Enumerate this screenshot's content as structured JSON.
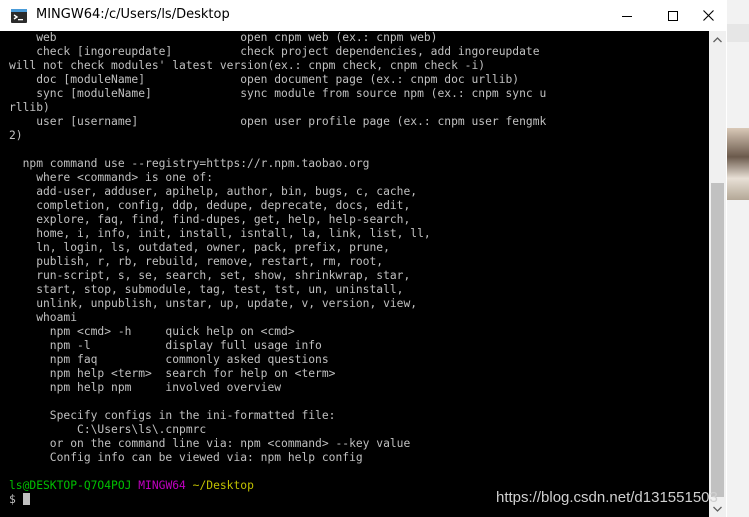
{
  "window": {
    "title": "MINGW64:/c/Users/ls/Desktop"
  },
  "terminal": {
    "lines": [
      "    web                           open cnpm web (ex.: cnpm web)",
      "    check [ingoreupdate]          check project dependencies, add ingoreupdate",
      "will not check modules' latest version(ex.: cnpm check, cnpm check -i)",
      "    doc [moduleName]              open document page (ex.: cnpm doc urllib)",
      "    sync [moduleName]             sync module from source npm (ex.: cnpm sync u",
      "rllib)",
      "    user [username]               open user profile page (ex.: cnpm user fengmk",
      "2)",
      "",
      "  npm command use --registry=https://r.npm.taobao.org",
      "    where <command> is one of:",
      "    add-user, adduser, apihelp, author, bin, bugs, c, cache,",
      "    completion, config, ddp, dedupe, deprecate, docs, edit,",
      "    explore, faq, find, find-dupes, get, help, help-search,",
      "    home, i, info, init, install, isntall, la, link, list, ll,",
      "    ln, login, ls, outdated, owner, pack, prefix, prune,",
      "    publish, r, rb, rebuild, remove, restart, rm, root,",
      "    run-script, s, se, search, set, show, shrinkwrap, star,",
      "    start, stop, submodule, tag, test, tst, un, uninstall,",
      "    unlink, unpublish, unstar, up, update, v, version, view,",
      "    whoami",
      "      npm <cmd> -h     quick help on <cmd>",
      "      npm -l           display full usage info",
      "      npm faq          commonly asked questions",
      "      npm help <term>  search for help on <term>",
      "      npm help npm     involved overview",
      "",
      "      Specify configs in the ini-formatted file:",
      "          C:\\Users\\ls\\.cnpmrc",
      "      or on the command line via: npm <command> --key value",
      "      Config info can be viewed via: npm help config",
      ""
    ],
    "prompt": {
      "user_host": "ls@DESKTOP-Q7O4POJ",
      "system": "MINGW64",
      "path": "~/Desktop",
      "symbol": "$ "
    }
  },
  "watermark": "https://blog.csdn.net/d131551503",
  "icons": {
    "app": "git-bash-icon",
    "minimize": "minimize-icon",
    "maximize": "maximize-icon",
    "close": "close-icon"
  },
  "colors": {
    "terminal_bg": "#000000",
    "terminal_fg": "#c0c0c0",
    "prompt_user": "#00c000",
    "prompt_system": "#c000c0",
    "prompt_path": "#c0c000"
  }
}
